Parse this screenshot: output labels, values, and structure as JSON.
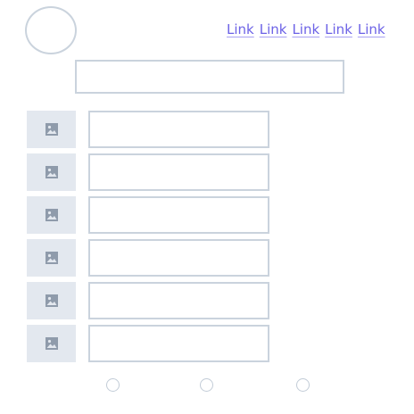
{
  "header": {
    "logo_icon": "circle-logo",
    "nav_links": [
      {
        "label": "Link"
      },
      {
        "label": "Link"
      },
      {
        "label": "Link"
      },
      {
        "label": "Link"
      },
      {
        "label": "Link"
      }
    ]
  },
  "search": {
    "value": "",
    "placeholder": ""
  },
  "list": {
    "items": [
      {
        "thumbnail_icon": "image-icon",
        "value": ""
      },
      {
        "thumbnail_icon": "image-icon",
        "value": ""
      },
      {
        "thumbnail_icon": "image-icon",
        "value": ""
      },
      {
        "thumbnail_icon": "image-icon",
        "value": ""
      },
      {
        "thumbnail_icon": "image-icon",
        "value": ""
      },
      {
        "thumbnail_icon": "image-icon",
        "value": ""
      }
    ]
  },
  "pagination": {
    "dots": [
      {
        "selected": false
      },
      {
        "selected": false
      },
      {
        "selected": false
      }
    ]
  },
  "colors": {
    "link": "#6c62e6",
    "border": "#cad3dd",
    "thumbnail_bg": "#e3e8ef",
    "icon": "#8f9bab"
  }
}
